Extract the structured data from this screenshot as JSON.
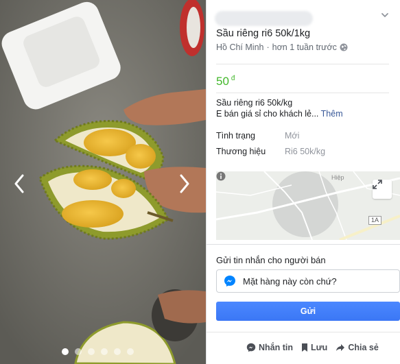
{
  "listing": {
    "title": "Sầu riêng ri6 50k/1kg",
    "location": "Hồ Chí Minh",
    "separator": "·",
    "time": "hơn 1 tuần trước",
    "price": "50",
    "currency": "đ",
    "description_line1": "Sầu riêng ri6 50k/kg",
    "description_line2": "E bán giá sỉ cho khách lẻ...",
    "see_more": "Thêm",
    "attributes": [
      {
        "label": "Tình trạng",
        "value": "Mới"
      },
      {
        "label": "Thương hiệu",
        "value": "Ri6 50k/kg"
      }
    ]
  },
  "map": {
    "label_road": "1A",
    "label_area": "Hiệp"
  },
  "message": {
    "header": "Gửi tin nhắn cho người bán",
    "input_value": "Mặt hàng này còn chứ?",
    "send_label": "Gửi"
  },
  "actions": {
    "message_label": "Nhắn tin",
    "save_label": "Lưu",
    "share_label": "Chia sẻ"
  },
  "gallery": {
    "photo_count": 6,
    "active_index": 0
  },
  "colors": {
    "price": "#42b72a",
    "send_button": "#4080ff",
    "link": "#385898"
  }
}
